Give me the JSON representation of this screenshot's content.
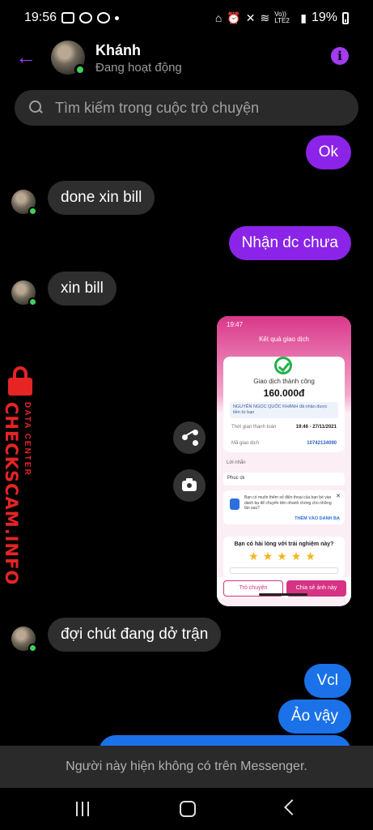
{
  "status_bar": {
    "time": "19:56",
    "network": "Vo)) LTE2",
    "battery": "19%"
  },
  "header": {
    "contact_name": "Khánh",
    "contact_status": "Đang hoạt động"
  },
  "search": {
    "placeholder": "Tìm kiếm trong cuộc trò chuyện"
  },
  "messages": [
    {
      "direction": "out",
      "text": "Ok"
    },
    {
      "direction": "in",
      "text": "done xin bill"
    },
    {
      "direction": "out",
      "text": "Nhận dc chưa"
    },
    {
      "direction": "in",
      "text": "xin bill"
    },
    {
      "direction": "in",
      "text": "đợi chút đang dở trận"
    },
    {
      "direction": "out",
      "text": "Vcl"
    },
    {
      "direction": "out",
      "text": "Ảo vậy"
    }
  ],
  "shared_image": {
    "time": "19:47",
    "title": "Kết quả giao dịch",
    "status": "Giao dịch thành công",
    "amount": "160.000đ",
    "note": "NGUYỄN NGỌC QUỐC KHÁNH đã nhận được tiền từ bạn",
    "time_label": "Thời gian thanh toán",
    "time_value": "19:46 - 27/11/2021",
    "tx_label": "Mã giao dịch",
    "tx_value": "10742134090",
    "message_label": "Lời nhắn",
    "message_value": "Phuc ck",
    "promo_text": "Bạn có muốn thêm số điện thoại của bạn bè vào danh bạ để chuyển tiền nhanh chóng cho những lần sau?",
    "promo_link": "THÊM VÀO DANH BẠ",
    "rating_question": "Bạn có hài lòng với trải nghiệm này?",
    "stars": "★★★★★",
    "btn_chat": "Trò chuyện",
    "btn_share": "Chia sẻ ảnh này"
  },
  "watermark": {
    "main": "CHECKSCAM.INFO",
    "sub": "DATA CENTER"
  },
  "banner": {
    "unavailable": "Người này hiện không có trên Messenger."
  },
  "icons": {
    "back": "arrow-left-icon",
    "info": "info-icon",
    "search": "search-icon",
    "share": "share-icon",
    "camera": "camera-icon"
  },
  "colors": {
    "accent_purple": "#8b24e8",
    "outgoing_blue": "#1b72e8",
    "incoming_gray": "#2e2e2e",
    "online_green": "#3fd15a",
    "watermark_red": "#e62424"
  }
}
